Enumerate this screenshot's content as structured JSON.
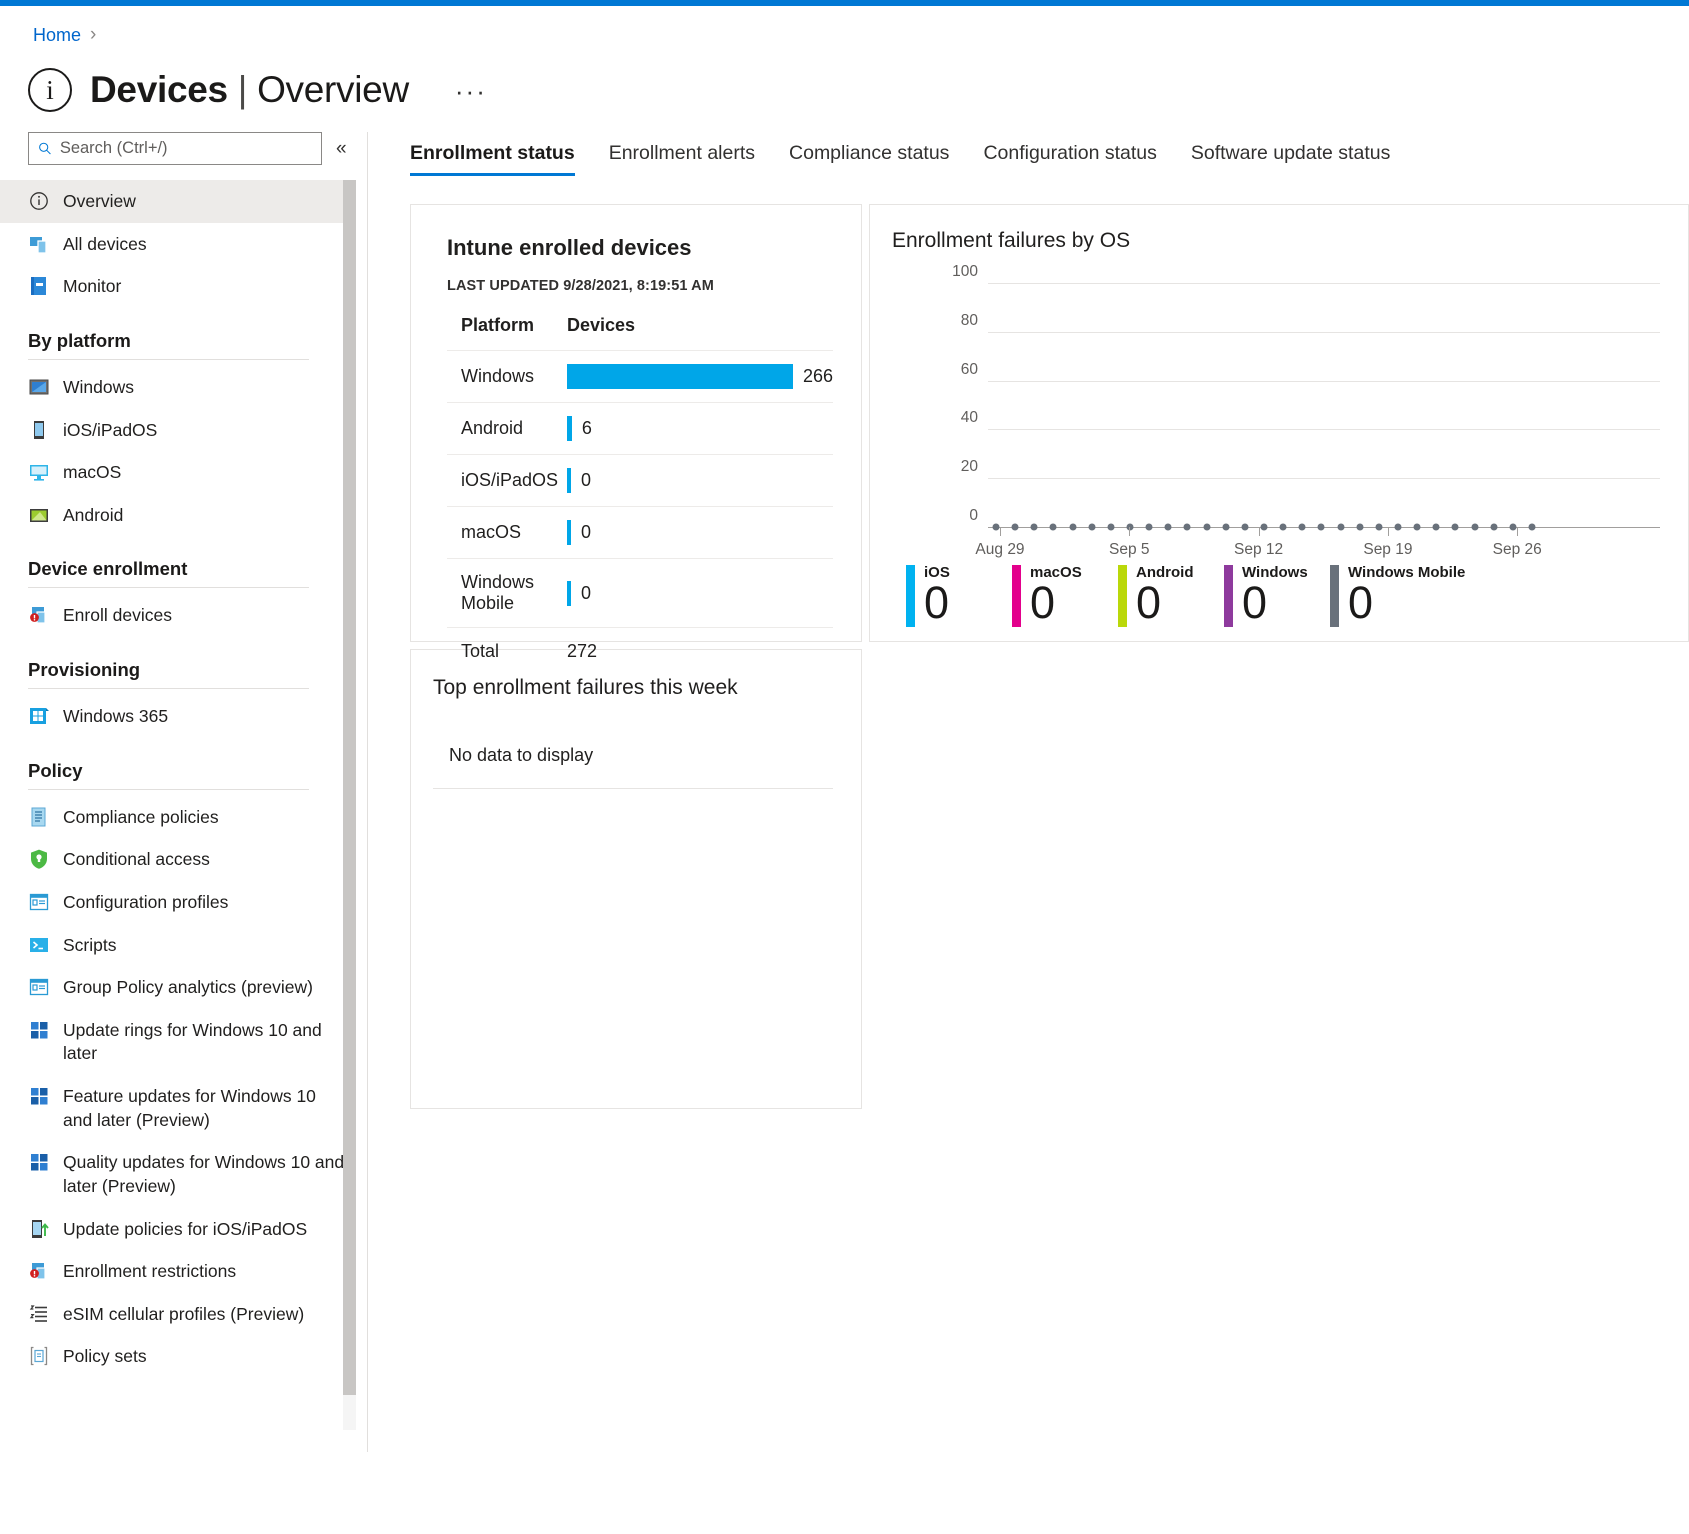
{
  "theme": {
    "accent": "#0078d4",
    "bar_blue": "#00a6e8",
    "link_blue": "#0066cc"
  },
  "breadcrumb": {
    "home_label": "Home",
    "separator": "›"
  },
  "header": {
    "title": "Devices",
    "divider": "|",
    "subtitle": "Overview",
    "info_glyph": "i",
    "more_label": "···"
  },
  "search": {
    "placeholder": "Search (Ctrl+/)",
    "value": "",
    "icon": "search-icon",
    "collapse_glyph": "«"
  },
  "sidebar": {
    "items": [
      {
        "label": "Overview",
        "icon": "info-circle-icon",
        "selected": true
      },
      {
        "label": "All devices",
        "icon": "all-devices-icon",
        "selected": false
      },
      {
        "label": "Monitor",
        "icon": "monitor-book-icon",
        "selected": false
      }
    ],
    "sections": [
      {
        "title": "By platform",
        "items": [
          {
            "label": "Windows",
            "icon": "windows-screen-icon"
          },
          {
            "label": "iOS/iPadOS",
            "icon": "ios-phone-icon"
          },
          {
            "label": "macOS",
            "icon": "macos-display-icon"
          },
          {
            "label": "Android",
            "icon": "android-icon"
          }
        ]
      },
      {
        "title": "Device enrollment",
        "items": [
          {
            "label": "Enroll devices",
            "icon": "enroll-devices-icon"
          }
        ]
      },
      {
        "title": "Provisioning",
        "items": [
          {
            "label": "Windows 365",
            "icon": "windows-365-icon"
          }
        ]
      },
      {
        "title": "Policy",
        "items": [
          {
            "label": "Compliance policies",
            "icon": "compliance-scroll-icon"
          },
          {
            "label": "Conditional access",
            "icon": "shield-icon"
          },
          {
            "label": "Configuration profiles",
            "icon": "config-profile-icon"
          },
          {
            "label": "Scripts",
            "icon": "scripts-terminal-icon"
          },
          {
            "label": "Group Policy analytics (preview)",
            "icon": "config-profile-icon"
          },
          {
            "label": "Update rings for Windows 10 and later",
            "icon": "windows-logo-icon"
          },
          {
            "label": "Feature updates for Windows 10 and later (Preview)",
            "icon": "windows-logo-icon"
          },
          {
            "label": "Quality updates for Windows 10 and later (Preview)",
            "icon": "windows-logo-icon"
          },
          {
            "label": "Update policies for iOS/iPadOS",
            "icon": "ios-update-icon"
          },
          {
            "label": "Enrollment restrictions",
            "icon": "enroll-devices-icon"
          },
          {
            "label": "eSIM cellular profiles (Preview)",
            "icon": "esim-list-icon"
          },
          {
            "label": "Policy sets",
            "icon": "policy-sets-icon"
          }
        ]
      }
    ]
  },
  "tabs": [
    {
      "label": "Enrollment status",
      "active": true
    },
    {
      "label": "Enrollment alerts",
      "active": false
    },
    {
      "label": "Compliance status",
      "active": false
    },
    {
      "label": "Configuration status",
      "active": false
    },
    {
      "label": "Software update status",
      "active": false
    }
  ],
  "enrolled_devices": {
    "title": "Intune enrolled devices",
    "last_updated": "LAST UPDATED 9/28/2021, 8:19:51 AM",
    "columns": [
      "Platform",
      "Devices"
    ],
    "rows": [
      {
        "platform": "Windows",
        "devices": "266",
        "bar_pct": 100
      },
      {
        "platform": "Android",
        "devices": "6",
        "bar_pct": 2.2
      },
      {
        "platform": "iOS/iPadOS",
        "devices": "0",
        "bar_pct": 1.2
      },
      {
        "platform": "macOS",
        "devices": "0",
        "bar_pct": 1.2
      },
      {
        "platform": "Windows Mobile",
        "devices": "0",
        "bar_pct": 1.2
      }
    ],
    "total_label": "Total",
    "total_value": "272"
  },
  "top_failures": {
    "title": "Top enrollment failures this week",
    "empty_text": "No data to display"
  },
  "chart_data": {
    "type": "line",
    "title": "Enrollment failures by OS",
    "xlabel": "",
    "ylabel": "",
    "ylim": [
      0,
      100
    ],
    "yticks": [
      100,
      80,
      60,
      40,
      20,
      0
    ],
    "grid": true,
    "xticks": [
      "Aug 29",
      "Sep 5",
      "Sep 12",
      "Sep 19",
      "Sep 26"
    ],
    "x_points": 29,
    "series": [
      {
        "name": "iOS",
        "color": "#00b2f0",
        "total": "0",
        "values_all_zero": true
      },
      {
        "name": "macOS",
        "color": "#e3008c",
        "total": "0",
        "values_all_zero": true
      },
      {
        "name": "Android",
        "color": "#bad80a",
        "total": "0",
        "values_all_zero": true
      },
      {
        "name": "Windows",
        "color": "#8e3a9d",
        "total": "0",
        "values_all_zero": true
      },
      {
        "name": "Windows Mobile",
        "color": "#69717b",
        "total": "0",
        "values_all_zero": true
      }
    ],
    "legend_position": "bottom",
    "marker_color": "#69717b"
  }
}
